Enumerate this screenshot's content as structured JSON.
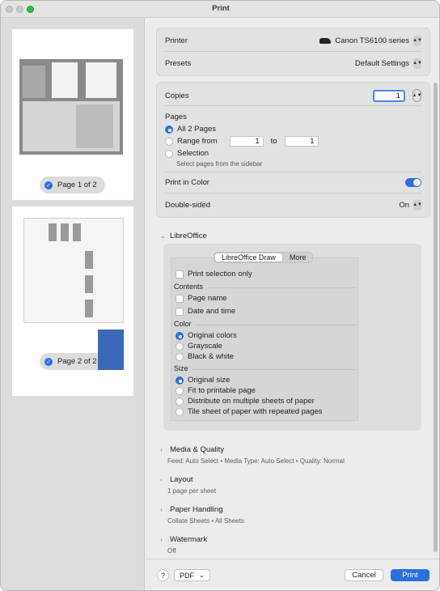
{
  "window": {
    "title": "Print"
  },
  "sidebar": {
    "pages": [
      {
        "label": "Page 1 of 2"
      },
      {
        "label": "Page 2 of 2"
      }
    ]
  },
  "settings": {
    "printer": {
      "label": "Printer",
      "value": "Canon TS6100 series"
    },
    "presets": {
      "label": "Presets",
      "value": "Default Settings"
    },
    "copies": {
      "label": "Copies",
      "value": "1"
    },
    "pages": {
      "label": "Pages",
      "all": "All 2 Pages",
      "range_label": "Range from",
      "range_from": "1",
      "range_to_label": "to",
      "range_to": "1",
      "selection": "Selection",
      "selection_hint": "Select pages from the sidebar"
    },
    "print_in_color": {
      "label": "Print in Color",
      "on": true
    },
    "double_sided": {
      "label": "Double-sided",
      "value": "On"
    }
  },
  "libreoffice": {
    "heading": "LibreOffice",
    "tabs": [
      "LibreOffice Draw",
      "More"
    ],
    "print_selection_only": "Print selection only",
    "contents": {
      "label": "Contents",
      "page_name": "Page name",
      "date_time": "Date and time"
    },
    "color": {
      "label": "Color",
      "options": [
        "Original colors",
        "Grayscale",
        "Black & white"
      ]
    },
    "size": {
      "label": "Size",
      "options": [
        "Original size",
        "Fit to printable page",
        "Distribute on multiple sheets of paper",
        "Tile sheet of paper with repeated pages"
      ]
    }
  },
  "sections": [
    {
      "title": "Media & Quality",
      "summary": "Feed: Auto Select • Media Type: Auto Select • Quality: Normal"
    },
    {
      "title": "Layout",
      "summary": "1 page per sheet"
    },
    {
      "title": "Paper Handling",
      "summary": "Collate Sheets • All Sheets"
    },
    {
      "title": "Watermark",
      "summary": "Off"
    }
  ],
  "footer": {
    "help": "?",
    "pdf": "PDF",
    "cancel": "Cancel",
    "print": "Print"
  },
  "colors": {
    "accent": "#2a6fe0"
  }
}
